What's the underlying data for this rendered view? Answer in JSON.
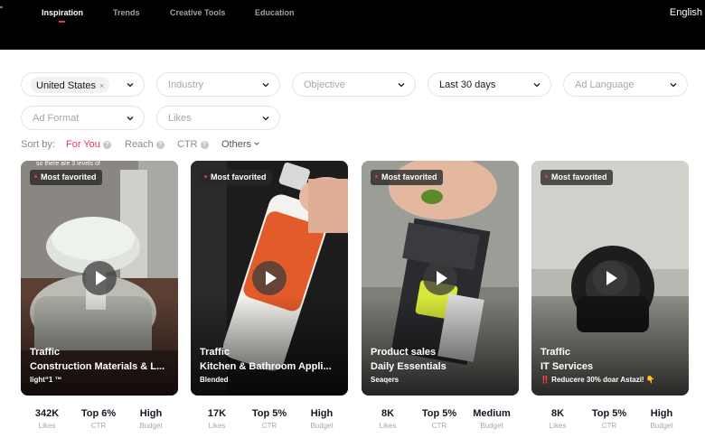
{
  "nav": {
    "items": [
      "Inspiration",
      "Trends",
      "Creative Tools",
      "Education"
    ],
    "active": "Inspiration",
    "language": "English"
  },
  "filters": {
    "country": {
      "value": "United States",
      "clear": "×"
    },
    "industry": {
      "placeholder": "Industry"
    },
    "objective": {
      "placeholder": "Objective"
    },
    "period": {
      "value": "Last 30 days"
    },
    "ad_language": {
      "placeholder": "Ad Language"
    },
    "ad_format": {
      "placeholder": "Ad Format"
    },
    "likes": {
      "placeholder": "Likes"
    }
  },
  "sort": {
    "label": "Sort by:",
    "options": [
      "For You",
      "Reach",
      "CTR",
      "Others"
    ],
    "active": "For You",
    "help": "?"
  },
  "cards": [
    {
      "badge": "Most favorited",
      "objective": "Traffic",
      "industry": "Construction Materials & L...",
      "brand": "light“1 ™",
      "overlay": "so there are 3 levels of",
      "metrics": [
        {
          "value": "342K",
          "label": "Likes"
        },
        {
          "value": "Top 6%",
          "label": "CTR"
        },
        {
          "value": "High",
          "label": "Budget"
        }
      ]
    },
    {
      "badge": "Most favorited",
      "objective": "Traffic",
      "industry": "Kitchen & Bathroom Appli...",
      "brand": "Blended",
      "overlay": "",
      "metrics": [
        {
          "value": "17K",
          "label": "Likes"
        },
        {
          "value": "Top 5%",
          "label": "CTR"
        },
        {
          "value": "High",
          "label": "Budget"
        }
      ]
    },
    {
      "badge": "Most favorited",
      "objective": "Product sales",
      "industry": "Daily Essentials",
      "brand": "Seaqers",
      "overlay": "",
      "metrics": [
        {
          "value": "8K",
          "label": "Likes"
        },
        {
          "value": "Top 5%",
          "label": "CTR"
        },
        {
          "value": "Medium",
          "label": "Budget"
        }
      ]
    },
    {
      "badge": "Most favorited",
      "objective": "Traffic",
      "industry": "IT Services",
      "brand": "‼️ Reducere 30% doar Astazi! 👇",
      "overlay": "",
      "metrics": [
        {
          "value": "8K",
          "label": "Likes"
        },
        {
          "value": "Top 5%",
          "label": "CTR"
        },
        {
          "value": "High",
          "label": "Budget"
        }
      ]
    }
  ],
  "colors": {
    "accent": "#fe2c55",
    "topbar": "#000000"
  },
  "icons": [
    "chevron-down-icon",
    "play-icon",
    "help-icon",
    "close-icon"
  ]
}
